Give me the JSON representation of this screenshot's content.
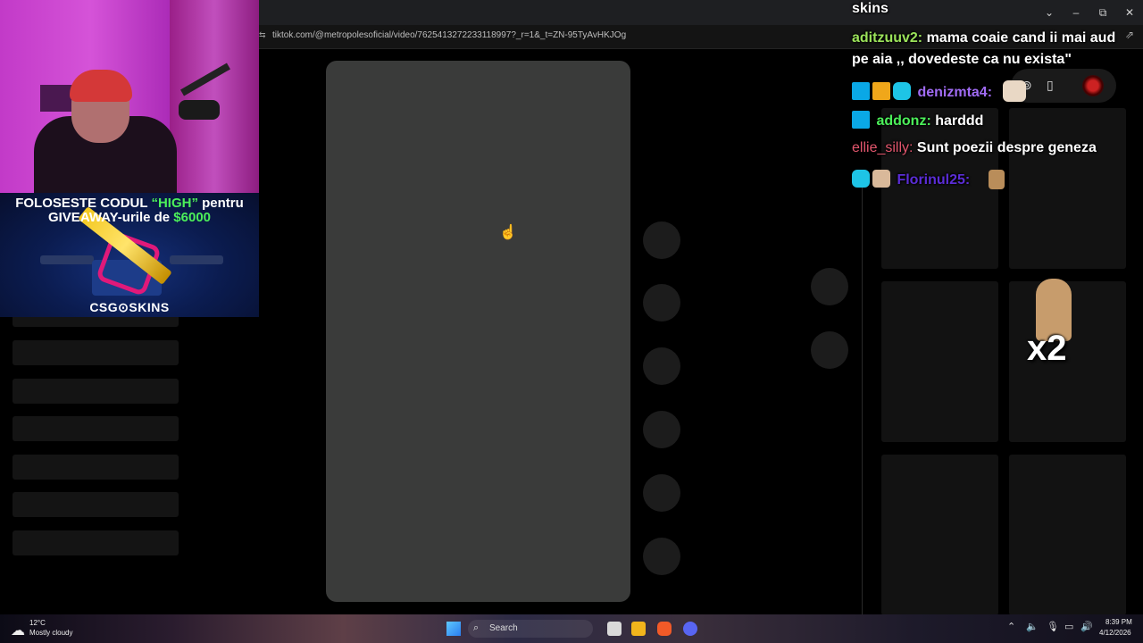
{
  "browser": {
    "url": "tiktok.com/@metropolesoficial/video/7625413272233118997?_r=1&_t=ZN-95TyAvHKJOg",
    "window_controls": [
      "⌄",
      "–",
      "⧉",
      "✕"
    ]
  },
  "overlay": {
    "promo_line1_pre": "FOLOSESTE CODUL ",
    "promo_code": "“HIGH”",
    "promo_line1_post": " pentru",
    "promo_line2_pre": "GIVEAWAY-urile de ",
    "promo_amount": "$6000",
    "promo_brand": "CSG⊙SKINS"
  },
  "chat": {
    "title": "skins",
    "messages": [
      {
        "user": "aditzuuv2:",
        "color": "#9be35a",
        "text": "mama coaie cand ii mai aud",
        "cont": "pe aia ,, dovedeste ca nu exista\""
      },
      {
        "user": "denizmta4:",
        "color": "#a06bf3",
        "text": ""
      },
      {
        "user": "addonz:",
        "color": "#4cf05a",
        "text": "harddd"
      },
      {
        "user": "ellie_silly:",
        "color": "#e2566d",
        "text": "Sunt poezii despre geneza"
      },
      {
        "user": "Florinul25:",
        "color": "#5b2dd6",
        "text": ""
      }
    ],
    "combo": "x2"
  },
  "taskbar": {
    "weather_temp": "12°C",
    "weather_desc": "Mostly cloudy",
    "search_label": "Search",
    "time": "8:39 PM",
    "date": "4/12/2026"
  }
}
